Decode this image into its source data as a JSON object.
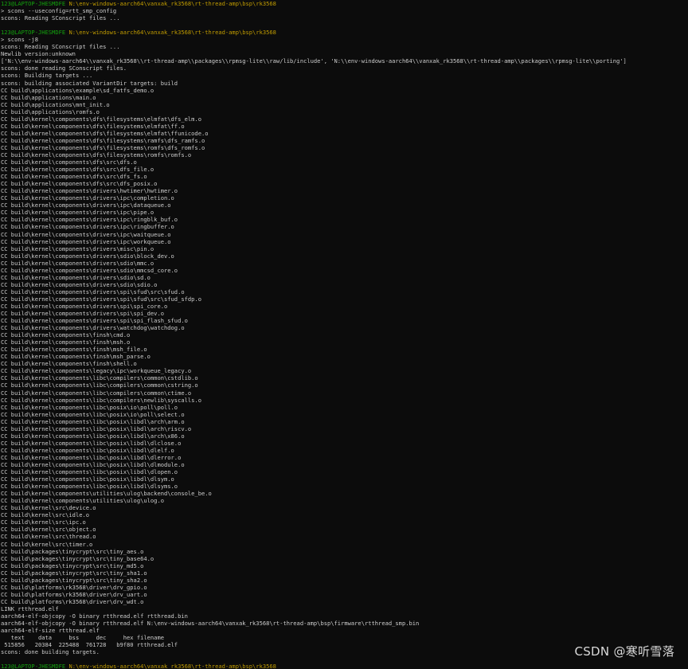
{
  "terminal": {
    "lines": [
      {
        "kind": "prompt",
        "user": "123@LAPTOP-JHESMDFE",
        "path": "N:\\env-windows-aarch64\\vanxak_rk3568\\rt-thread-amp\\bsp\\rk3568"
      },
      {
        "kind": "command",
        "text": "> scons --useconfig=rtt_smp_config"
      },
      {
        "kind": "text",
        "text": "scons: Reading SConscript files ..."
      },
      {
        "kind": "text",
        "text": ""
      },
      {
        "kind": "prompt",
        "user": "123@LAPTOP-JHESMDFE",
        "path": "N:\\env-windows-aarch64\\vanxak_rk3568\\rt-thread-amp\\bsp\\rk3568"
      },
      {
        "kind": "command",
        "text": "> scons -j8"
      },
      {
        "kind": "text",
        "text": "scons: Reading SConscript files ..."
      },
      {
        "kind": "text",
        "text": "Newlib version:unknown"
      },
      {
        "kind": "text",
        "text": "['N:\\\\env-windows-aarch64\\\\vanxak_rk3568\\\\rt-thread-amp\\\\packages\\\\rpmsg-lite\\\\raw/lib/include', 'N:\\\\env-windows-aarch64\\\\vanxak_rk3568\\\\rt-thread-amp\\\\packages\\\\rpmsg-lite\\\\porting']"
      },
      {
        "kind": "text",
        "text": "scons: done reading SConscript files."
      },
      {
        "kind": "text",
        "text": "scons: Building targets ..."
      },
      {
        "kind": "text",
        "text": "scons: building associated VariantDir targets: build"
      },
      {
        "kind": "text",
        "text": "CC build\\applications\\example\\sd_fatfs_demo.o"
      },
      {
        "kind": "text",
        "text": "CC build\\applications\\main.o"
      },
      {
        "kind": "text",
        "text": "CC build\\applications\\mnt_init.o"
      },
      {
        "kind": "text",
        "text": "CC build\\applications\\romfs.o"
      },
      {
        "kind": "text",
        "text": "CC build\\kernel\\components\\dfs\\filesystems\\elmfat\\dfs_elm.o"
      },
      {
        "kind": "text",
        "text": "CC build\\kernel\\components\\dfs\\filesystems\\elmfat\\ff.o"
      },
      {
        "kind": "text",
        "text": "CC build\\kernel\\components\\dfs\\filesystems\\elmfat\\ffunicode.o"
      },
      {
        "kind": "text",
        "text": "CC build\\kernel\\components\\dfs\\filesystems\\ramfs\\dfs_ramfs.o"
      },
      {
        "kind": "text",
        "text": "CC build\\kernel\\components\\dfs\\filesystems\\romfs\\dfs_romfs.o"
      },
      {
        "kind": "text",
        "text": "CC build\\kernel\\components\\dfs\\filesystems\\romfs\\romfs.o"
      },
      {
        "kind": "text",
        "text": "CC build\\kernel\\components\\dfs\\src\\dfs.o"
      },
      {
        "kind": "text",
        "text": "CC build\\kernel\\components\\dfs\\src\\dfs_file.o"
      },
      {
        "kind": "text",
        "text": "CC build\\kernel\\components\\dfs\\src\\dfs_fs.o"
      },
      {
        "kind": "text",
        "text": "CC build\\kernel\\components\\dfs\\src\\dfs_posix.o"
      },
      {
        "kind": "text",
        "text": "CC build\\kernel\\components\\drivers\\hwtimer\\hwtimer.o"
      },
      {
        "kind": "text",
        "text": "CC build\\kernel\\components\\drivers\\ipc\\completion.o"
      },
      {
        "kind": "text",
        "text": "CC build\\kernel\\components\\drivers\\ipc\\dataqueue.o"
      },
      {
        "kind": "text",
        "text": "CC build\\kernel\\components\\drivers\\ipc\\pipe.o"
      },
      {
        "kind": "text",
        "text": "CC build\\kernel\\components\\drivers\\ipc\\ringblk_buf.o"
      },
      {
        "kind": "text",
        "text": "CC build\\kernel\\components\\drivers\\ipc\\ringbuffer.o"
      },
      {
        "kind": "text",
        "text": "CC build\\kernel\\components\\drivers\\ipc\\waitqueue.o"
      },
      {
        "kind": "text",
        "text": "CC build\\kernel\\components\\drivers\\ipc\\workqueue.o"
      },
      {
        "kind": "text",
        "text": "CC build\\kernel\\components\\drivers\\misc\\pin.o"
      },
      {
        "kind": "text",
        "text": "CC build\\kernel\\components\\drivers\\sdio\\block_dev.o"
      },
      {
        "kind": "text",
        "text": "CC build\\kernel\\components\\drivers\\sdio\\mmc.o"
      },
      {
        "kind": "text",
        "text": "CC build\\kernel\\components\\drivers\\sdio\\mmcsd_core.o"
      },
      {
        "kind": "text",
        "text": "CC build\\kernel\\components\\drivers\\sdio\\sd.o"
      },
      {
        "kind": "text",
        "text": "CC build\\kernel\\components\\drivers\\sdio\\sdio.o"
      },
      {
        "kind": "text",
        "text": "CC build\\kernel\\components\\drivers\\spi\\sfud\\src\\sfud.o"
      },
      {
        "kind": "text",
        "text": "CC build\\kernel\\components\\drivers\\spi\\sfud\\src\\sfud_sfdp.o"
      },
      {
        "kind": "text",
        "text": "CC build\\kernel\\components\\drivers\\spi\\spi_core.o"
      },
      {
        "kind": "text",
        "text": "CC build\\kernel\\components\\drivers\\spi\\spi_dev.o"
      },
      {
        "kind": "text",
        "text": "CC build\\kernel\\components\\drivers\\spi\\spi_flash_sfud.o"
      },
      {
        "kind": "text",
        "text": "CC build\\kernel\\components\\drivers\\watchdog\\watchdog.o"
      },
      {
        "kind": "text",
        "text": "CC build\\kernel\\components\\finsh\\cmd.o"
      },
      {
        "kind": "text",
        "text": "CC build\\kernel\\components\\finsh\\msh.o"
      },
      {
        "kind": "text",
        "text": "CC build\\kernel\\components\\finsh\\msh_file.o"
      },
      {
        "kind": "text",
        "text": "CC build\\kernel\\components\\finsh\\msh_parse.o"
      },
      {
        "kind": "text",
        "text": "CC build\\kernel\\components\\finsh\\shell.o"
      },
      {
        "kind": "text",
        "text": "CC build\\kernel\\components\\legacy\\ipc\\workqueue_legacy.o"
      },
      {
        "kind": "text",
        "text": "CC build\\kernel\\components\\libc\\compilers\\common\\cstdlib.o"
      },
      {
        "kind": "text",
        "text": "CC build\\kernel\\components\\libc\\compilers\\common\\cstring.o"
      },
      {
        "kind": "text",
        "text": "CC build\\kernel\\components\\libc\\compilers\\common\\ctime.o"
      },
      {
        "kind": "text",
        "text": "CC build\\kernel\\components\\libc\\compilers\\newlib\\syscalls.o"
      },
      {
        "kind": "text",
        "text": "CC build\\kernel\\components\\libc\\posix\\io\\poll\\poll.o"
      },
      {
        "kind": "text",
        "text": "CC build\\kernel\\components\\libc\\posix\\io\\poll\\select.o"
      },
      {
        "kind": "text",
        "text": "CC build\\kernel\\components\\libc\\posix\\libdl\\arch\\arm.o"
      },
      {
        "kind": "text",
        "text": "CC build\\kernel\\components\\libc\\posix\\libdl\\arch\\riscv.o"
      },
      {
        "kind": "text",
        "text": "CC build\\kernel\\components\\libc\\posix\\libdl\\arch\\x86.o"
      },
      {
        "kind": "text",
        "text": "CC build\\kernel\\components\\libc\\posix\\libdl\\dlclose.o"
      },
      {
        "kind": "text",
        "text": "CC build\\kernel\\components\\libc\\posix\\libdl\\dlelf.o"
      },
      {
        "kind": "text",
        "text": "CC build\\kernel\\components\\libc\\posix\\libdl\\dlerror.o"
      },
      {
        "kind": "text",
        "text": "CC build\\kernel\\components\\libc\\posix\\libdl\\dlmodule.o"
      },
      {
        "kind": "text",
        "text": "CC build\\kernel\\components\\libc\\posix\\libdl\\dlopen.o"
      },
      {
        "kind": "text",
        "text": "CC build\\kernel\\components\\libc\\posix\\libdl\\dlsym.o"
      },
      {
        "kind": "text",
        "text": "CC build\\kernel\\components\\libc\\posix\\libdl\\dlsyms.o"
      },
      {
        "kind": "text",
        "text": "CC build\\kernel\\components\\utilities\\ulog\\backend\\console_be.o"
      },
      {
        "kind": "text",
        "text": "CC build\\kernel\\components\\utilities\\ulog\\ulog.o"
      },
      {
        "kind": "text",
        "text": "CC build\\kernel\\src\\device.o"
      },
      {
        "kind": "text",
        "text": "CC build\\kernel\\src\\idle.o"
      },
      {
        "kind": "text",
        "text": "CC build\\kernel\\src\\ipc.o"
      },
      {
        "kind": "text",
        "text": "CC build\\kernel\\src\\object.o"
      },
      {
        "kind": "text",
        "text": "CC build\\kernel\\src\\thread.o"
      },
      {
        "kind": "text",
        "text": "CC build\\kernel\\src\\timer.o"
      },
      {
        "kind": "text",
        "text": "CC build\\packages\\tinycrypt\\src\\tiny_aes.o"
      },
      {
        "kind": "text",
        "text": "CC build\\packages\\tinycrypt\\src\\tiny_base64.o"
      },
      {
        "kind": "text",
        "text": "CC build\\packages\\tinycrypt\\src\\tiny_md5.o"
      },
      {
        "kind": "text",
        "text": "CC build\\packages\\tinycrypt\\src\\tiny_sha1.o"
      },
      {
        "kind": "text",
        "text": "CC build\\packages\\tinycrypt\\src\\tiny_sha2.o"
      },
      {
        "kind": "text",
        "text": "CC build\\platforms\\rk3568\\driver\\drv_gpio.o"
      },
      {
        "kind": "text",
        "text": "CC build\\platforms\\rk3568\\driver\\drv_uart.o"
      },
      {
        "kind": "text",
        "text": "CC build\\platforms\\rk3568\\driver\\drv_wdt.o"
      },
      {
        "kind": "text",
        "text": "LINK rtthread.elf"
      },
      {
        "kind": "text",
        "text": "aarch64-elf-objcopy -O binary rtthread.elf rtthread.bin"
      },
      {
        "kind": "text",
        "text": "aarch64-elf-objcopy -O binary rtthread.elf N:\\env-windows-aarch64\\vanxak_rk3568\\rt-thread-amp\\bsp\\firmware\\rtthread_smp.bin"
      },
      {
        "kind": "text",
        "text": "aarch64-elf-size rtthread.elf"
      },
      {
        "kind": "text",
        "text": "   text    data     bss     dec     hex filename"
      },
      {
        "kind": "text",
        "text": " 515856   20384  225488  761728   b9f80 rtthread.elf"
      },
      {
        "kind": "text",
        "text": "scons: done building targets."
      },
      {
        "kind": "text",
        "text": ""
      },
      {
        "kind": "prompt",
        "user": "123@LAPTOP-JHESMDFE",
        "path": "N:\\env-windows-aarch64\\vanxak_rk3568\\rt-thread-amp\\bsp\\rk3568"
      },
      {
        "kind": "cursor",
        "text": ">"
      }
    ]
  },
  "watermark": "CSDN @寒听雪落",
  "colors": {
    "background": "#0c0c0c",
    "text": "#cccccc",
    "user": "#13a10e",
    "path": "#c19c00"
  }
}
